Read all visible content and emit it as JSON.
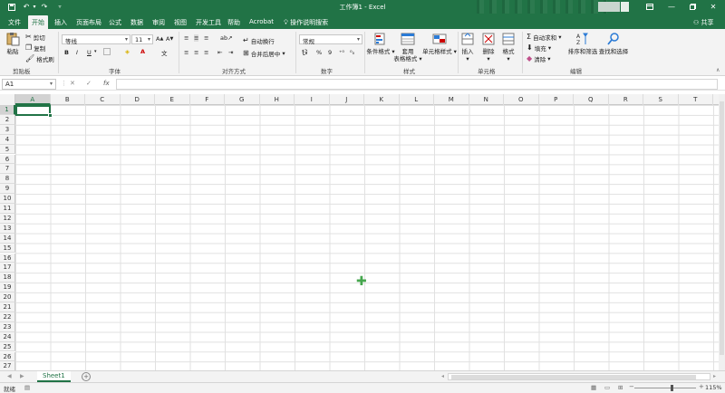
{
  "title": "工作簿1 - Excel",
  "tabs": [
    {
      "label": "文件"
    },
    {
      "label": "开始"
    },
    {
      "label": "插入"
    },
    {
      "label": "页面布局"
    },
    {
      "label": "公式"
    },
    {
      "label": "数据"
    },
    {
      "label": "审阅"
    },
    {
      "label": "视图"
    },
    {
      "label": "开发工具"
    },
    {
      "label": "帮助"
    },
    {
      "label": "Acrobat"
    }
  ],
  "tell_me": "操作说明搜索",
  "share": "共享",
  "ribbon": {
    "clipboard": {
      "paste": "粘贴",
      "cut": "剪切",
      "copy": "复制",
      "format_painter": "格式刷",
      "label": "剪贴板"
    },
    "font": {
      "name": "等线",
      "size": "11",
      "bold": "B",
      "italic": "I",
      "underline": "U",
      "label": "字体"
    },
    "alignment": {
      "wrap": "自动换行",
      "merge": "合并后居中",
      "label": "对齐方式"
    },
    "number": {
      "format": "常规",
      "percent": "%",
      "comma": "9",
      "label": "数字"
    },
    "styles": {
      "conditional": "条件格式",
      "table_l1": "套用",
      "table_l2": "表格格式",
      "cell_styles": "单元格样式",
      "label": "样式"
    },
    "cells": {
      "insert": "插入",
      "delete": "删除",
      "format": "格式",
      "label": "单元格"
    },
    "editing": {
      "autosum": "自动求和",
      "fill": "填充",
      "clear": "清除",
      "sort": "排序和筛选",
      "find": "查找和选择",
      "label": "编辑"
    }
  },
  "formula_bar": {
    "name_box": "A1",
    "fx": "fx",
    "value": ""
  },
  "columns": [
    "A",
    "B",
    "C",
    "D",
    "E",
    "F",
    "G",
    "H",
    "I",
    "J",
    "K",
    "L",
    "M",
    "N",
    "O",
    "P",
    "Q",
    "R",
    "S",
    "T"
  ],
  "rows": [
    "1",
    "2",
    "3",
    "4",
    "5",
    "6",
    "7",
    "8",
    "9",
    "10",
    "11",
    "12",
    "13",
    "14",
    "15",
    "16",
    "17",
    "18",
    "19",
    "20",
    "21",
    "22",
    "23",
    "24",
    "25",
    "26",
    "27"
  ],
  "selected_column": "A",
  "selected_row": "1",
  "sheets": [
    {
      "label": "Sheet1"
    }
  ],
  "status": {
    "ready": "就绪",
    "zoom": "115%"
  },
  "colors": {
    "accent": "#217346",
    "ribbon_bg": "#f3f3f3",
    "grid_line": "#e1e1e1"
  }
}
